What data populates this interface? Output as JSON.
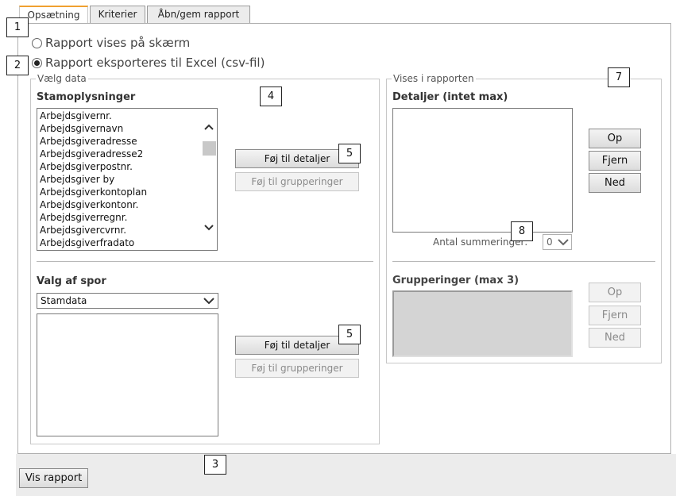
{
  "tabs": [
    {
      "label": "Opsætning"
    },
    {
      "label": "Kriterier"
    },
    {
      "label": "Åbn/gem rapport"
    }
  ],
  "mode": {
    "screen_label": "Rapport vises på skærm",
    "excel_label": "Rapport eksporteres til Excel (csv-fil)"
  },
  "vaelg_data": {
    "legend": "Vælg data",
    "stamoplysninger": {
      "header": "Stamoplysninger",
      "items": [
        "Arbejdsgivernr.",
        "Arbejdsgivernavn",
        "Arbejdsgiveradresse",
        "Arbejdsgiveradresse2",
        "Arbejdsgiverpostnr.",
        "Arbejdsgiver by",
        "Arbejdsgiverkontoplan",
        "Arbejdsgiverkontonr.",
        "Arbejdsgiverregnr.",
        "Arbejdsgivercvrnr.",
        "Arbejdsgiverfradato"
      ],
      "add_details": "Føj til detaljer",
      "add_groups": "Føj til grupperinger"
    },
    "valg_af_spor": {
      "header": "Valg af spor",
      "selected": "Stamdata",
      "add_details": "Føj til detaljer",
      "add_groups": "Føj til grupperinger"
    }
  },
  "vises": {
    "legend": "Vises i rapporten",
    "detaljer": {
      "header": "Detaljer (intet max)",
      "up": "Op",
      "remove": "Fjern",
      "down": "Ned",
      "sum_label": "Antal summeringer:",
      "sum_value": "0"
    },
    "grupperinger": {
      "header": "Grupperinger (max 3)",
      "up": "Op",
      "remove": "Fjern",
      "down": "Ned"
    }
  },
  "footer": {
    "show_report": "Vis rapport"
  },
  "callouts": [
    "1",
    "2",
    "3",
    "4",
    "5",
    "5",
    "7",
    "8"
  ]
}
